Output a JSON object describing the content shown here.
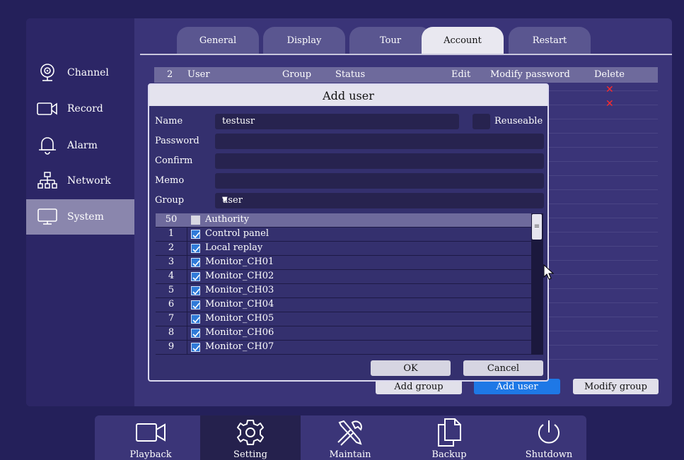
{
  "sidebar": {
    "items": [
      {
        "label": "Channel",
        "icon": "camera-icon"
      },
      {
        "label": "Record",
        "icon": "video-camera-icon"
      },
      {
        "label": "Alarm",
        "icon": "bell-icon"
      },
      {
        "label": "Network",
        "icon": "network-icon"
      },
      {
        "label": "System",
        "icon": "monitor-icon",
        "active": true
      }
    ]
  },
  "tabs": [
    {
      "label": "General"
    },
    {
      "label": "Display"
    },
    {
      "label": "Tour"
    },
    {
      "label": "Account",
      "active": true
    },
    {
      "label": "Restart"
    }
  ],
  "table": {
    "count": "2",
    "columns": [
      "User",
      "Group",
      "Status",
      "Edit",
      "Modify password",
      "Delete"
    ]
  },
  "bottom_buttons": {
    "add_group": "Add group",
    "add_user": "Add user",
    "modify_group": "Modify group"
  },
  "dialog": {
    "title": "Add user",
    "name_label": "Name",
    "name_value": "testusr",
    "reuseable_label": "Reuseable",
    "password_label": "Password",
    "confirm_label": "Confirm",
    "memo_label": "Memo",
    "group_label": "Group",
    "group_value": "user",
    "authority_count": "50",
    "authority_header": "Authority",
    "authorities": [
      {
        "num": "1",
        "label": "Control panel"
      },
      {
        "num": "2",
        "label": "Local replay"
      },
      {
        "num": "3",
        "label": "Monitor_CH01"
      },
      {
        "num": "4",
        "label": "Monitor_CH02"
      },
      {
        "num": "5",
        "label": "Monitor_CH03"
      },
      {
        "num": "6",
        "label": "Monitor_CH04"
      },
      {
        "num": "7",
        "label": "Monitor_CH05"
      },
      {
        "num": "8",
        "label": "Monitor_CH06"
      },
      {
        "num": "9",
        "label": "Monitor_CH07"
      }
    ],
    "ok_label": "OK",
    "cancel_label": "Cancel"
  },
  "taskbar": [
    {
      "label": "Playback",
      "icon": "playback-camera-icon"
    },
    {
      "label": "Setting",
      "icon": "gear-icon",
      "active": true
    },
    {
      "label": "Maintain",
      "icon": "tools-icon"
    },
    {
      "label": "Backup",
      "icon": "copy-icon"
    },
    {
      "label": "Shutdown",
      "icon": "power-icon"
    }
  ],
  "colors": {
    "background": "#24205a",
    "panel": "#3a3478",
    "accent_blue": "#1e78e6",
    "delete_red": "#ff2a2a"
  }
}
